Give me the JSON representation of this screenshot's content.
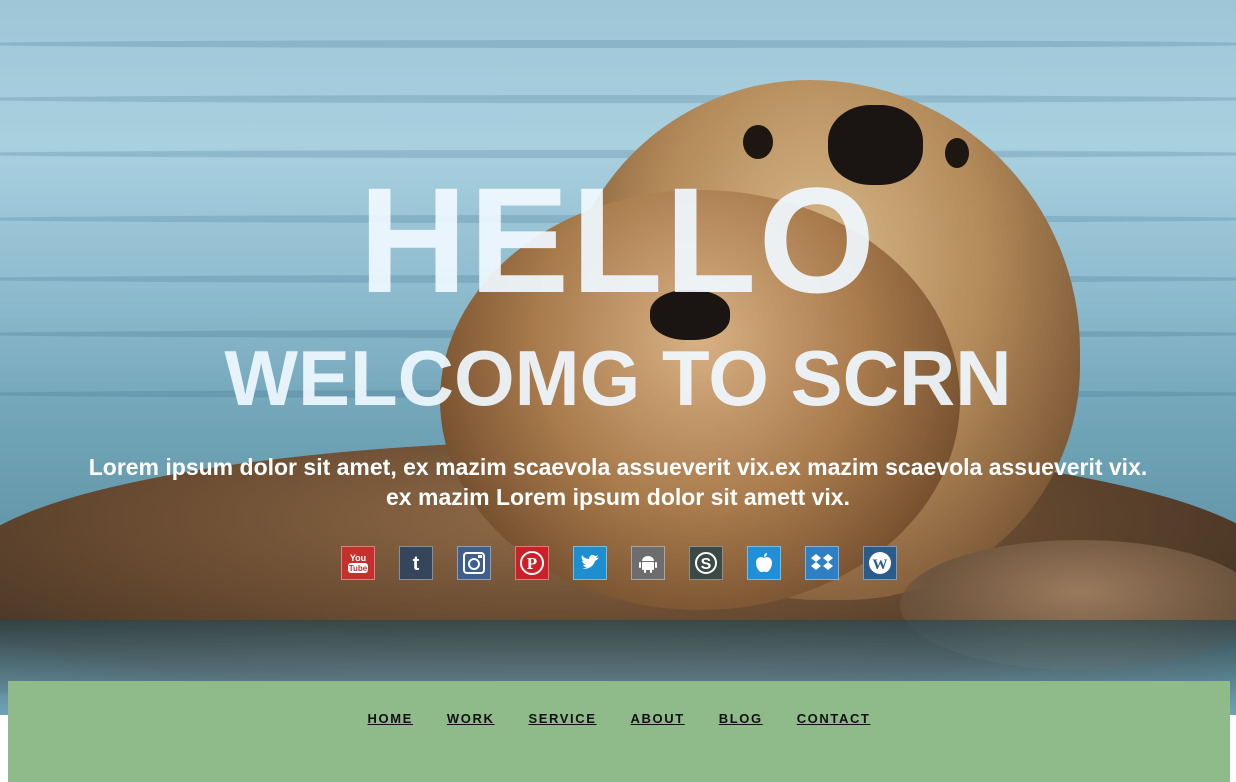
{
  "hero": {
    "title": "HELLO",
    "subtitle": "WELCOMG TO SCRN",
    "description_line1": "Lorem ipsum dolor sit amet, ex mazim scaevola assueverit vix.ex mazim scaevola assueverit vix.",
    "description_line2": "ex mazim Lorem ipsum dolor sit amett vix."
  },
  "social_icons": [
    {
      "name": "youtube-icon",
      "label": "You Tube",
      "color": "#c4302b"
    },
    {
      "name": "tumblr-icon",
      "label": "t",
      "color": "#35465c"
    },
    {
      "name": "instagram-icon",
      "label": "instagram",
      "color": "#3f5e8c"
    },
    {
      "name": "pinterest-icon",
      "label": "P",
      "color": "#cb2027"
    },
    {
      "name": "twitter-icon",
      "label": "twitter",
      "color": "#1d8fd1"
    },
    {
      "name": "android-icon",
      "label": "android",
      "color": "#6d6d6d"
    },
    {
      "name": "skype-icon",
      "label": "S",
      "color": "#3b4a44"
    },
    {
      "name": "apple-icon",
      "label": "apple",
      "color": "#1f8fd8"
    },
    {
      "name": "dropbox-icon",
      "label": "dropbox",
      "color": "#2e7fc4"
    },
    {
      "name": "wordpress-icon",
      "label": "W",
      "color": "#2a5b8a"
    }
  ],
  "nav": {
    "items": [
      "HOME",
      "WORK",
      "SERVICE",
      "ABOUT",
      "BLOG",
      "CONTACT"
    ],
    "background": "#8fbb8a"
  }
}
